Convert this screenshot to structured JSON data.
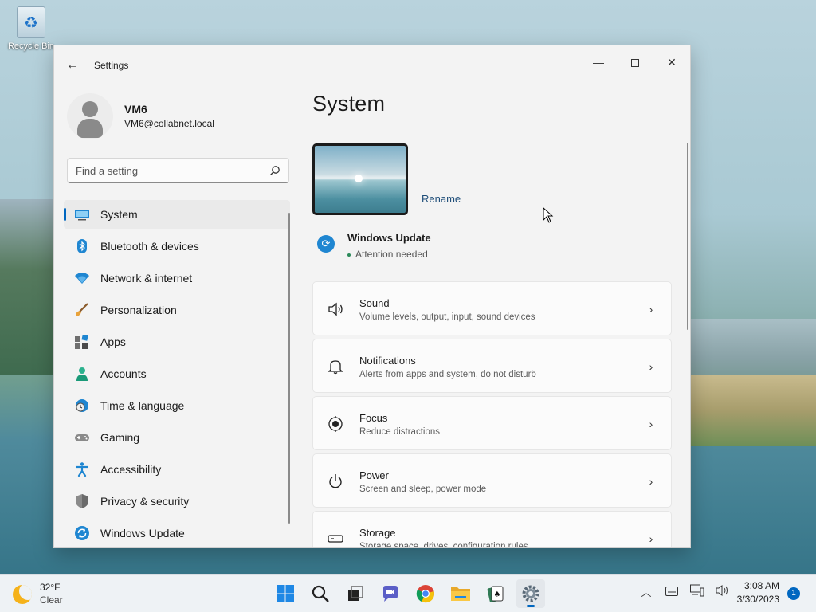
{
  "desktop": {
    "icons": [
      {
        "label": "Recycle Bin",
        "icon": "recycle-bin-icon"
      }
    ]
  },
  "window": {
    "title": "Settings",
    "controls": {
      "minimize": "minimize",
      "maximize": "maximize",
      "close": "close"
    }
  },
  "profile": {
    "name": "VM6",
    "email": "VM6@collabnet.local"
  },
  "search": {
    "placeholder": "Find a setting",
    "value": ""
  },
  "sidebar": {
    "items": [
      {
        "label": "System",
        "icon": "display-icon",
        "active": true
      },
      {
        "label": "Bluetooth & devices",
        "icon": "bluetooth-icon",
        "active": false
      },
      {
        "label": "Network & internet",
        "icon": "wifi-icon",
        "active": false
      },
      {
        "label": "Personalization",
        "icon": "brush-icon",
        "active": false
      },
      {
        "label": "Apps",
        "icon": "apps-icon",
        "active": false
      },
      {
        "label": "Accounts",
        "icon": "person-icon",
        "active": false
      },
      {
        "label": "Time & language",
        "icon": "globe-clock-icon",
        "active": false
      },
      {
        "label": "Gaming",
        "icon": "gamepad-icon",
        "active": false
      },
      {
        "label": "Accessibility",
        "icon": "accessibility-icon",
        "active": false
      },
      {
        "label": "Privacy & security",
        "icon": "shield-icon",
        "active": false
      },
      {
        "label": "Windows Update",
        "icon": "update-icon",
        "active": false
      }
    ]
  },
  "main": {
    "title": "System",
    "rename_label": "Rename",
    "windows_update": {
      "title": "Windows Update",
      "status": "Attention needed"
    },
    "cards": [
      {
        "title": "Sound",
        "subtitle": "Volume levels, output, input, sound devices",
        "icon": "speaker-icon"
      },
      {
        "title": "Notifications",
        "subtitle": "Alerts from apps and system, do not disturb",
        "icon": "bell-icon"
      },
      {
        "title": "Focus",
        "subtitle": "Reduce distractions",
        "icon": "focus-icon"
      },
      {
        "title": "Power",
        "subtitle": "Screen and sleep, power mode",
        "icon": "power-icon"
      },
      {
        "title": "Storage",
        "subtitle": "Storage space, drives, configuration rules",
        "icon": "storage-icon"
      }
    ]
  },
  "taskbar": {
    "weather": {
      "temp": "32°F",
      "condition": "Clear"
    },
    "apps": [
      {
        "name": "start",
        "icon": "windows-start-icon"
      },
      {
        "name": "search",
        "icon": "search-icon"
      },
      {
        "name": "task-view",
        "icon": "task-view-icon"
      },
      {
        "name": "chat",
        "icon": "chat-icon"
      },
      {
        "name": "chrome",
        "icon": "chrome-icon"
      },
      {
        "name": "file-explorer",
        "icon": "folder-icon"
      },
      {
        "name": "solitaire",
        "icon": "cards-icon"
      },
      {
        "name": "settings",
        "icon": "gear-icon",
        "active": true
      }
    ],
    "clock": {
      "time": "3:08 AM",
      "date": "3/30/2023"
    },
    "notification_count": "1"
  },
  "colors": {
    "accent": "#0067c0",
    "window_bg": "#f3f3f3",
    "card_bg": "#fbfbfb",
    "taskbar_bg": "#eef2f5"
  }
}
